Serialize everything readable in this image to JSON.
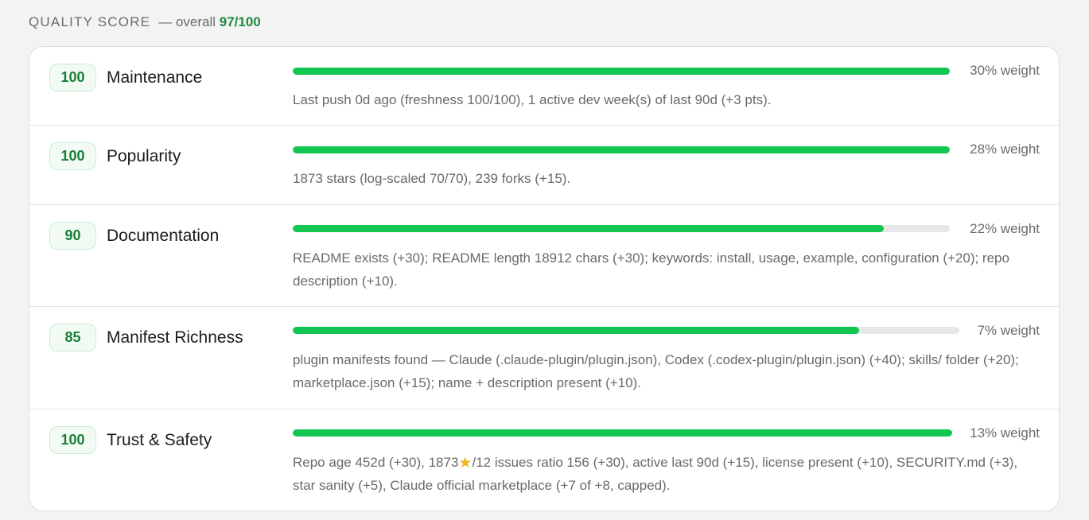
{
  "header": {
    "title": "QUALITY SCORE",
    "overall_prefix": "— overall",
    "overall_value": "97/100"
  },
  "accent_color": "#12c652",
  "badge_text_color": "#1c7f38",
  "rows": [
    {
      "score": "100",
      "name": "Maintenance",
      "progress": 1.0,
      "weight": "30% weight",
      "description": "Last push 0d ago (freshness 100/100), 1 active dev week(s) of last 90d (+3 pts)."
    },
    {
      "score": "100",
      "name": "Popularity",
      "progress": 1.0,
      "weight": "28% weight",
      "description": "1873 stars (log-scaled 70/70), 239 forks (+15)."
    },
    {
      "score": "90",
      "name": "Documentation",
      "progress": 0.9,
      "weight": "22% weight",
      "description": "README exists (+30); README length 18912 chars (+30); keywords: install, usage, example, configuration (+20); repo description (+10)."
    },
    {
      "score": "85",
      "name": "Manifest Richness",
      "progress": 0.85,
      "weight": "7% weight",
      "description": "plugin manifests found — Claude (.claude-plugin/plugin.json), Codex (.codex-plugin/plugin.json) (+40); skills/ folder (+20); marketplace.json (+15); name + description present (+10)."
    },
    {
      "score": "100",
      "name": "Trust & Safety",
      "progress": 1.0,
      "weight": "13% weight",
      "description_before_icon": "Repo age 452d (+30), 1873",
      "description_icon": "star-icon",
      "description_after_icon": "/12 issues ratio 156 (+30), active last 90d (+15), license present (+10), SECURITY.md (+3), star sanity (+5), Claude official marketplace (+7 of +8, capped)."
    }
  ]
}
